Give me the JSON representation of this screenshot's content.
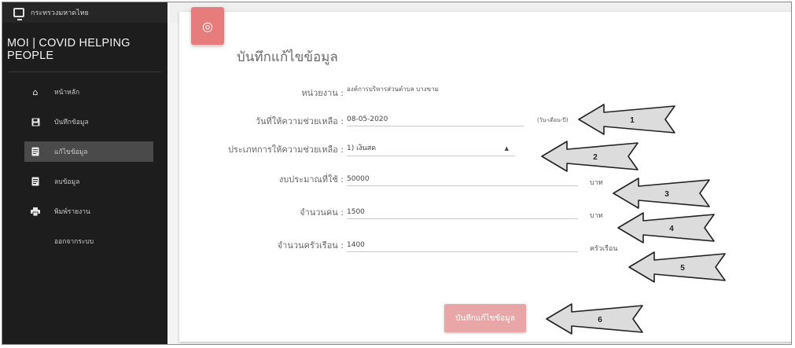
{
  "sidebar": {
    "ministry": "กระทรวงมหาดไทย",
    "app_title": "MOI | COVID HELPING PEOPLE",
    "items": [
      {
        "label": "หน้าหลัก",
        "icon": "home-icon"
      },
      {
        "label": "บันทึกข้อมูล",
        "icon": "save-icon"
      },
      {
        "label": "แก้ไขข้อมูล",
        "icon": "document-icon",
        "active": true
      },
      {
        "label": "ลบข้อมูล",
        "icon": "document-icon"
      },
      {
        "label": "พิมพ์รายงาน",
        "icon": "printer-icon"
      },
      {
        "label": "ออกจากระบบ",
        "icon": ""
      }
    ]
  },
  "form": {
    "title": "บันทึกแก้ไขข้อมูล",
    "fields": [
      {
        "label": "หน่วยงาน :",
        "value": "องค์การบริหารส่วนตำบล บางขาม"
      },
      {
        "label": "วันที่ให้ความช่วยเหลือ :",
        "value": "08-05-2020",
        "unit": "(วัน-เดือน-ปี)"
      },
      {
        "label": "ประเภทการให้ความช่วยเหลือ :",
        "value": "1) เงินสด"
      },
      {
        "label": "งบประมาณที่ใช้ :",
        "value": "50000",
        "unit": "บาท"
      },
      {
        "label": "จำนวนคน :",
        "value": "1500",
        "unit": "บาท"
      },
      {
        "label": "จำนวนครัวเรือน :",
        "value": "1400",
        "unit": "ครัวเรือน"
      }
    ],
    "save_label": "บันทึกแก้ไขข้อมูล"
  },
  "callouts": [
    "1",
    "2",
    "3",
    "4",
    "5",
    "6"
  ]
}
